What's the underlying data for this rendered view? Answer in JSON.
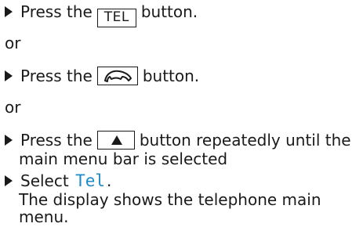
{
  "steps": {
    "s1": {
      "pre": "Press the",
      "key": "TEL",
      "post": "button."
    },
    "or1": "or",
    "s2": {
      "pre": "Press the",
      "key_icon": "phone-handset-icon",
      "post": "button."
    },
    "or2": "or",
    "s3": {
      "pre": "Press the",
      "key_icon": "up-arrow-icon",
      "post": "button repeatedly until the",
      "line2": "main menu bar is selected"
    },
    "s4": {
      "pre": "Select",
      "menu_item": "Tel",
      "post": ".",
      "line2": "The display shows the telephone main",
      "line3": "menu."
    }
  },
  "colors": {
    "menu_item": "#1f8ac9",
    "text": "#1a1a1a"
  }
}
